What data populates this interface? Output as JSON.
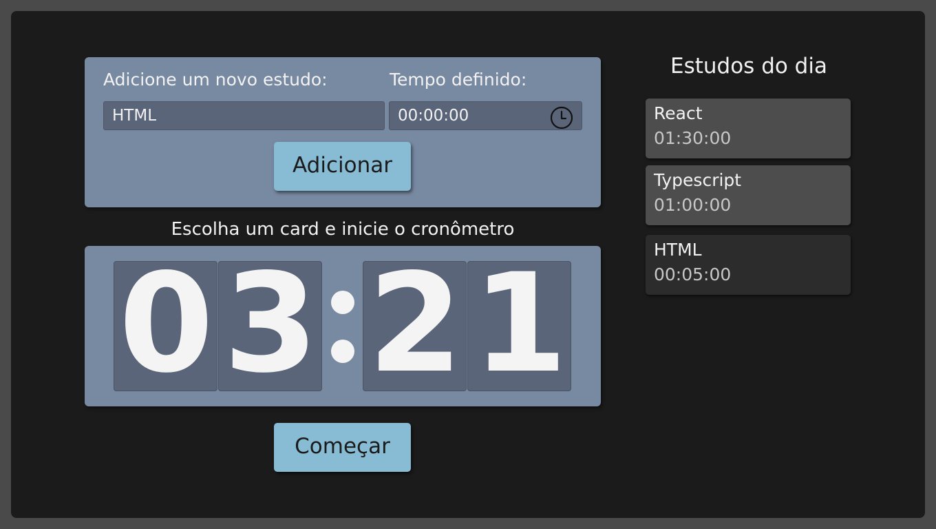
{
  "form": {
    "study_label": "Adicione um novo estudo:",
    "time_label": "Tempo definido:",
    "study_value": "HTML",
    "time_value": "00:00:00",
    "add_button": "Adicionar",
    "clock_icon": "clock-icon"
  },
  "timer": {
    "prompt": "Escolha um card e inicie o cronômetro",
    "digits": [
      "0",
      "3",
      "2",
      "1"
    ],
    "display": "03:21",
    "start_button": "Começar"
  },
  "sidebar": {
    "title": "Estudos do dia",
    "items": [
      {
        "name": "React",
        "time": "01:30:00",
        "selected": false
      },
      {
        "name": "Typescript",
        "time": "01:00:00",
        "selected": false
      },
      {
        "name": "HTML",
        "time": "00:05:00",
        "selected": true
      }
    ]
  },
  "colors": {
    "background": "#1b1b1b",
    "panel": "#7889a2",
    "field": "#5b6579",
    "button": "#88bcd4",
    "card": "#4d4d4d",
    "card_selected": "#2c2c2c"
  }
}
